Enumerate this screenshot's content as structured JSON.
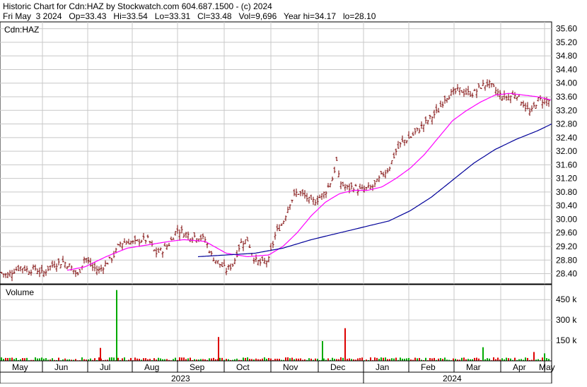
{
  "header": {
    "line1": "Historic Chart for Cdn:HAZ by Stockwatch.com 604.687.1500 - (c) 2024",
    "line2": "Fri May  3 2024   Op=33.43   Hi=33.54   Lo=33.31   Cl=33.48   Vol=9,696   Year hi=34.17   lo=28.10"
  },
  "chart_data": [
    {
      "type": "line",
      "title": "Cdn:HAZ",
      "ylim": [
        28.1,
        35.8
      ],
      "y_ticks": [
        "28.40",
        "28.80",
        "29.20",
        "29.60",
        "30.00",
        "30.40",
        "30.80",
        "31.20",
        "31.60",
        "32.00",
        "32.40",
        "32.80",
        "33.20",
        "33.60",
        "34.00",
        "34.40",
        "34.80",
        "35.20",
        "35.60"
      ],
      "x_months": [
        "May",
        "Jun",
        "Jul",
        "Aug",
        "Sep",
        "Oct",
        "Nov",
        "Dec",
        "Jan",
        "Feb",
        "Mar",
        "Apr",
        "May"
      ],
      "x_years": [
        "2023",
        "2024"
      ],
      "anchors_close": [
        [
          0,
          28.45
        ],
        [
          10,
          28.35
        ],
        [
          20,
          28.5
        ],
        [
          30,
          28.6
        ],
        [
          40,
          28.5
        ],
        [
          50,
          28.55
        ],
        [
          60,
          28.4
        ],
        [
          70,
          28.6
        ],
        [
          80,
          28.7
        ],
        [
          90,
          28.75
        ],
        [
          100,
          28.6
        ],
        [
          110,
          28.35
        ],
        [
          120,
          28.9
        ],
        [
          130,
          28.6
        ],
        [
          140,
          28.5
        ],
        [
          150,
          28.7
        ],
        [
          160,
          28.9
        ],
        [
          170,
          29.3
        ],
        [
          180,
          29.35
        ],
        [
          190,
          29.3
        ],
        [
          200,
          29.4
        ],
        [
          210,
          29.4
        ],
        [
          220,
          29.0
        ],
        [
          230,
          29.1
        ],
        [
          240,
          29.3
        ],
        [
          250,
          29.7
        ],
        [
          260,
          29.6
        ],
        [
          270,
          29.5
        ],
        [
          280,
          29.5
        ],
        [
          290,
          29.4
        ],
        [
          300,
          28.9
        ],
        [
          310,
          28.7
        ],
        [
          320,
          28.5
        ],
        [
          330,
          28.7
        ],
        [
          340,
          29.3
        ],
        [
          350,
          29.4
        ],
        [
          360,
          28.8
        ],
        [
          370,
          28.7
        ],
        [
          380,
          28.8
        ],
        [
          390,
          29.6
        ],
        [
          400,
          29.9
        ],
        [
          410,
          30.5
        ],
        [
          420,
          30.8
        ],
        [
          430,
          30.7
        ],
        [
          440,
          30.5
        ],
        [
          450,
          30.6
        ],
        [
          460,
          30.8
        ],
        [
          470,
          31.2
        ],
        [
          476,
          31.7
        ],
        [
          480,
          31.1
        ],
        [
          490,
          30.9
        ],
        [
          500,
          30.95
        ],
        [
          510,
          30.85
        ],
        [
          520,
          30.9
        ],
        [
          530,
          31.0
        ],
        [
          540,
          31.3
        ],
        [
          550,
          31.5
        ],
        [
          560,
          32.0
        ],
        [
          570,
          32.3
        ],
        [
          580,
          32.4
        ],
        [
          590,
          32.6
        ],
        [
          600,
          32.8
        ],
        [
          610,
          33.0
        ],
        [
          620,
          33.2
        ],
        [
          630,
          33.6
        ],
        [
          640,
          33.7
        ],
        [
          650,
          33.8
        ],
        [
          660,
          33.7
        ],
        [
          670,
          33.7
        ],
        [
          680,
          33.9
        ],
        [
          690,
          34.0
        ],
        [
          700,
          33.8
        ],
        [
          710,
          33.6
        ],
        [
          720,
          33.6
        ],
        [
          730,
          33.7
        ],
        [
          740,
          33.4
        ],
        [
          750,
          33.1
        ],
        [
          760,
          33.5
        ],
        [
          770,
          33.5
        ],
        [
          780,
          33.48
        ]
      ],
      "anchors_ma_short": [
        [
          95,
          28.5
        ],
        [
          120,
          28.6
        ],
        [
          150,
          28.9
        ],
        [
          180,
          29.15
        ],
        [
          210,
          29.25
        ],
        [
          240,
          29.35
        ],
        [
          260,
          29.4
        ],
        [
          290,
          29.35
        ],
        [
          320,
          29.0
        ],
        [
          350,
          28.9
        ],
        [
          380,
          28.95
        ],
        [
          400,
          29.2
        ],
        [
          420,
          29.6
        ],
        [
          440,
          30.1
        ],
        [
          460,
          30.5
        ],
        [
          480,
          30.75
        ],
        [
          500,
          30.85
        ],
        [
          520,
          30.85
        ],
        [
          540,
          30.95
        ],
        [
          560,
          31.2
        ],
        [
          580,
          31.5
        ],
        [
          600,
          31.9
        ],
        [
          620,
          32.4
        ],
        [
          640,
          32.9
        ],
        [
          660,
          33.2
        ],
        [
          680,
          33.45
        ],
        [
          700,
          33.65
        ],
        [
          720,
          33.7
        ],
        [
          740,
          33.65
        ],
        [
          760,
          33.6
        ],
        [
          780,
          33.5
        ]
      ],
      "anchors_ma_long": [
        [
          280,
          28.9
        ],
        [
          320,
          28.95
        ],
        [
          360,
          29.0
        ],
        [
          400,
          29.15
        ],
        [
          440,
          29.4
        ],
        [
          470,
          29.55
        ],
        [
          490,
          29.65
        ],
        [
          520,
          29.8
        ],
        [
          550,
          29.95
        ],
        [
          580,
          30.25
        ],
        [
          610,
          30.65
        ],
        [
          640,
          31.15
        ],
        [
          670,
          31.65
        ],
        [
          700,
          32.05
        ],
        [
          730,
          32.35
        ],
        [
          760,
          32.6
        ],
        [
          780,
          32.8
        ]
      ]
    },
    {
      "type": "bar",
      "title": "Volume",
      "ylim": [
        0,
        560
      ],
      "y_ticks": [
        {
          "v": 150,
          "label": "150 k"
        },
        {
          "v": 300,
          "label": "300 k"
        },
        {
          "v": 450,
          "label": "450 k"
        }
      ],
      "spikes": [
        {
          "x": 165,
          "v": 520,
          "color": "green"
        },
        {
          "x": 309,
          "v": 175,
          "color": "red"
        },
        {
          "x": 456,
          "v": 145,
          "color": "green"
        },
        {
          "x": 488,
          "v": 240,
          "color": "red"
        },
        {
          "x": 142,
          "v": 95,
          "color": "red"
        },
        {
          "x": 683,
          "v": 100,
          "color": "green"
        },
        {
          "x": 755,
          "v": 65,
          "color": "red"
        },
        {
          "x": 770,
          "v": 55,
          "color": "green"
        }
      ]
    }
  ],
  "colors": {
    "price_bar": "#7a0000",
    "ma_short": "#ff00ff",
    "ma_long": "#000099",
    "vol_up": "#00aa00",
    "vol_down": "#dd0000",
    "grid": "#c8c8c8"
  }
}
